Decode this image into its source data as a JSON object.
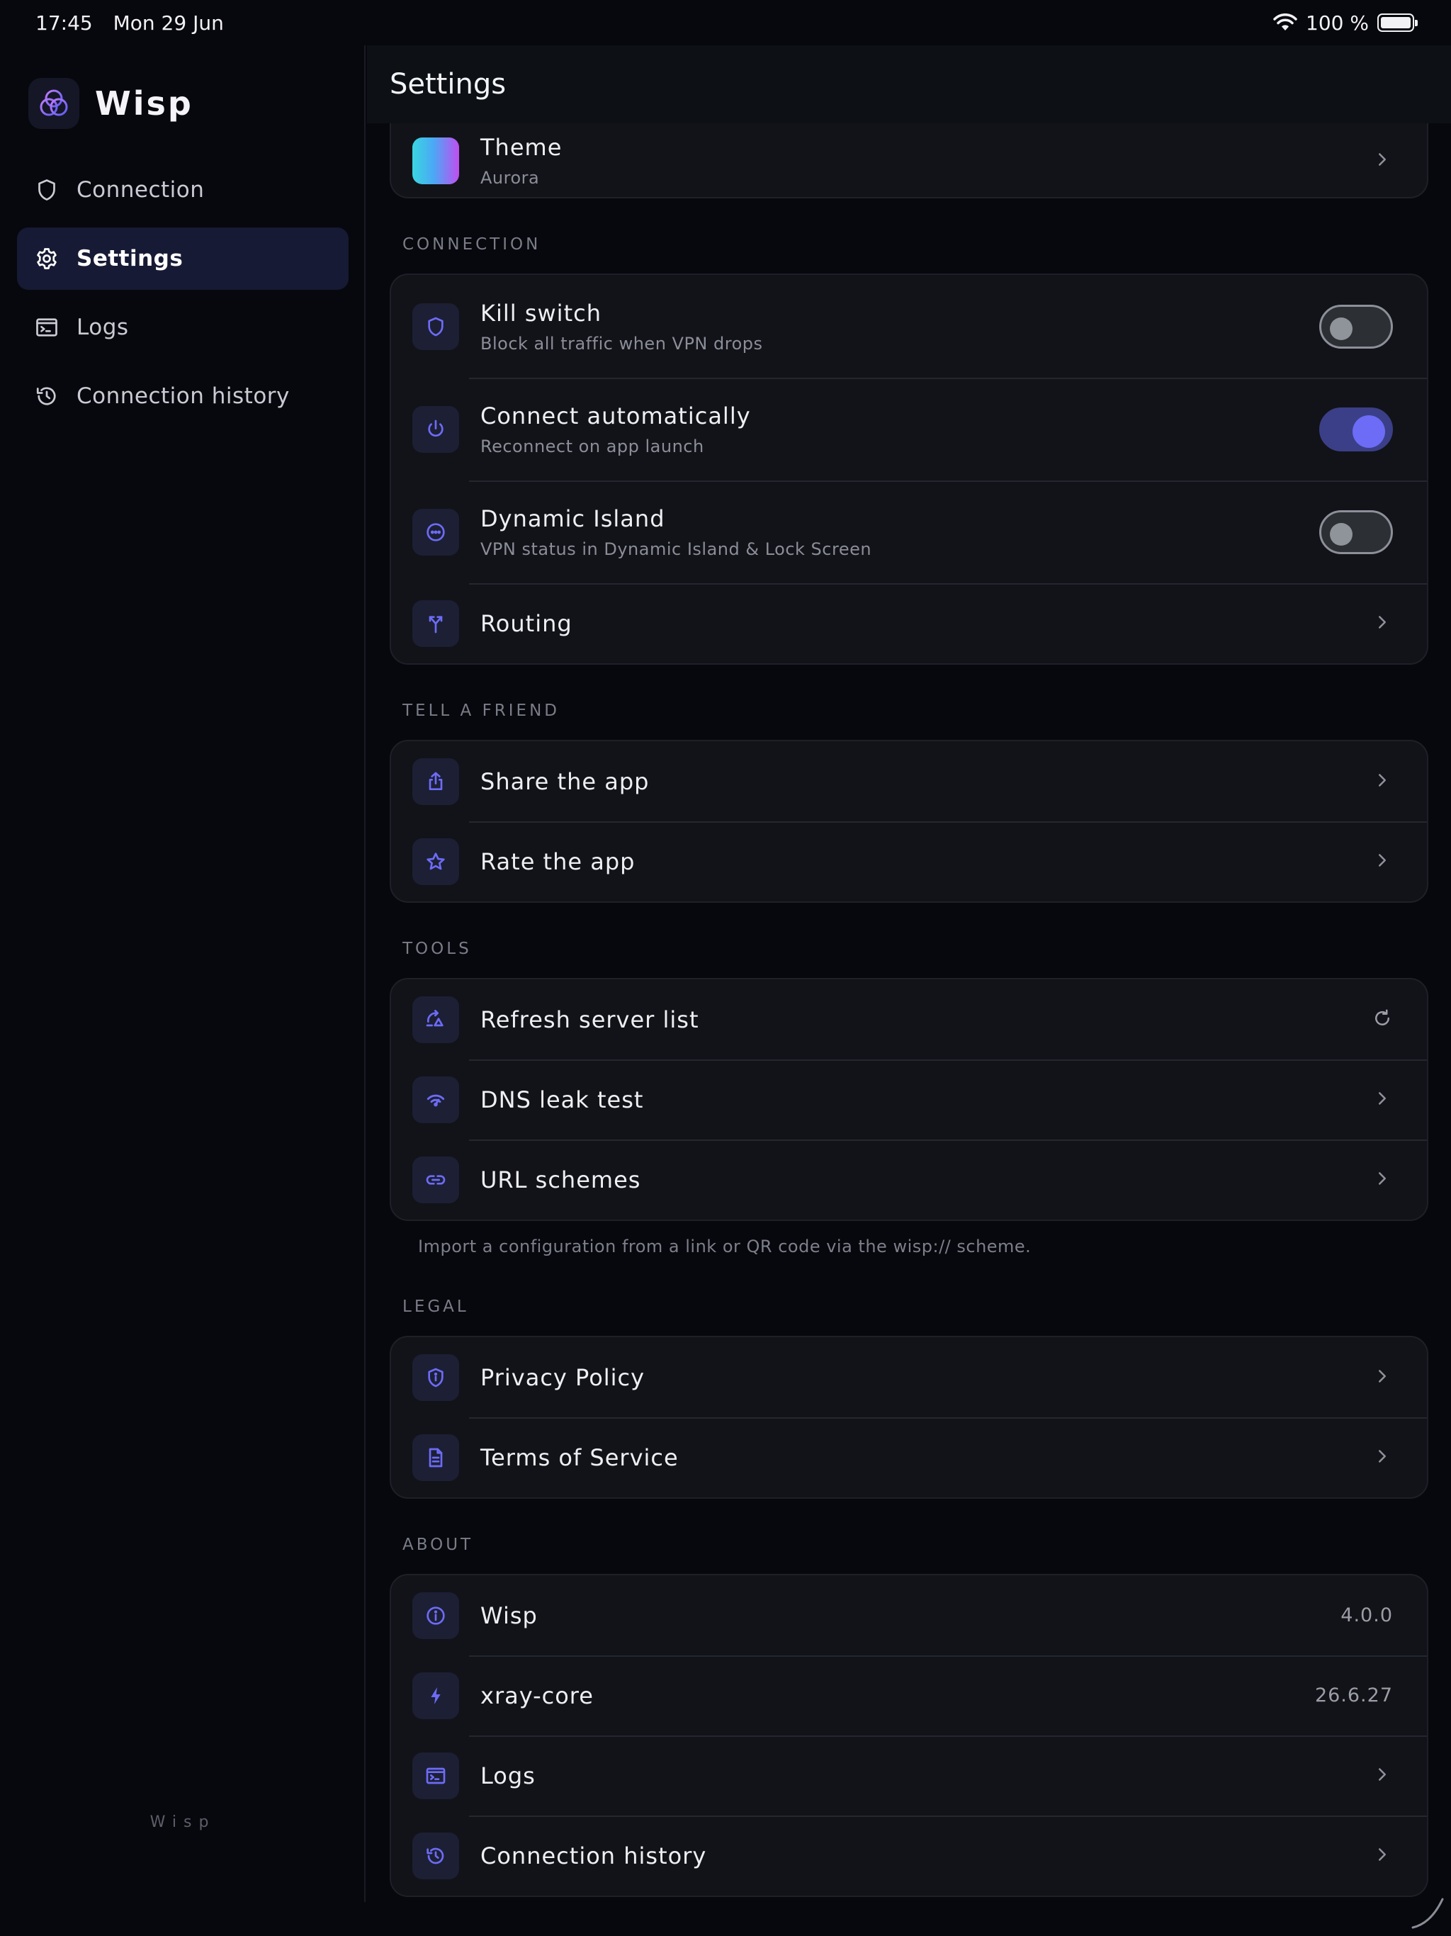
{
  "status_bar": {
    "time": "17:45",
    "date": "Mon 29 Jun",
    "battery": "100 %"
  },
  "sidebar": {
    "brand": "Wisp",
    "items": [
      {
        "label": "Connection",
        "icon": "shield-icon",
        "active": false
      },
      {
        "label": "Settings",
        "icon": "gear-icon",
        "active": true
      },
      {
        "label": "Logs",
        "icon": "terminal-icon",
        "active": false
      },
      {
        "label": "Connection history",
        "icon": "history-icon",
        "active": false
      }
    ],
    "footer": "Wisp"
  },
  "header": {
    "title": "Settings"
  },
  "theme": {
    "title": "Theme",
    "value": "Aurora"
  },
  "sections": {
    "connection": {
      "label": "CONNECTION",
      "kill_switch": {
        "title": "Kill switch",
        "subtitle": "Block all traffic when VPN drops",
        "enabled": false
      },
      "auto_connect": {
        "title": "Connect automatically",
        "subtitle": "Reconnect on app launch",
        "enabled": true
      },
      "dynamic_island": {
        "title": "Dynamic Island",
        "subtitle": "VPN status in Dynamic Island & Lock Screen",
        "enabled": false
      },
      "routing": {
        "title": "Routing"
      }
    },
    "tell_a_friend": {
      "label": "TELL A FRIEND",
      "share": {
        "title": "Share the app"
      },
      "rate": {
        "title": "Rate the app"
      }
    },
    "tools": {
      "label": "TOOLS",
      "refresh": {
        "title": "Refresh server list"
      },
      "dns": {
        "title": "DNS leak test"
      },
      "url_schemes": {
        "title": "URL schemes"
      },
      "footnote": "Import a configuration from a link or QR code via the wisp:// scheme."
    },
    "legal": {
      "label": "LEGAL",
      "privacy": {
        "title": "Privacy Policy"
      },
      "terms": {
        "title": "Terms of Service"
      }
    },
    "about": {
      "label": "ABOUT",
      "app": {
        "title": "Wisp",
        "value": "4.0.0"
      },
      "core": {
        "title": "xray-core",
        "value": "26.6.27"
      },
      "logs": {
        "title": "Logs"
      },
      "history": {
        "title": "Connection history"
      }
    }
  },
  "colors": {
    "accent": "#6c6cf6",
    "background": "#07080d",
    "card": "#121318",
    "active_nav": "#171a34"
  }
}
